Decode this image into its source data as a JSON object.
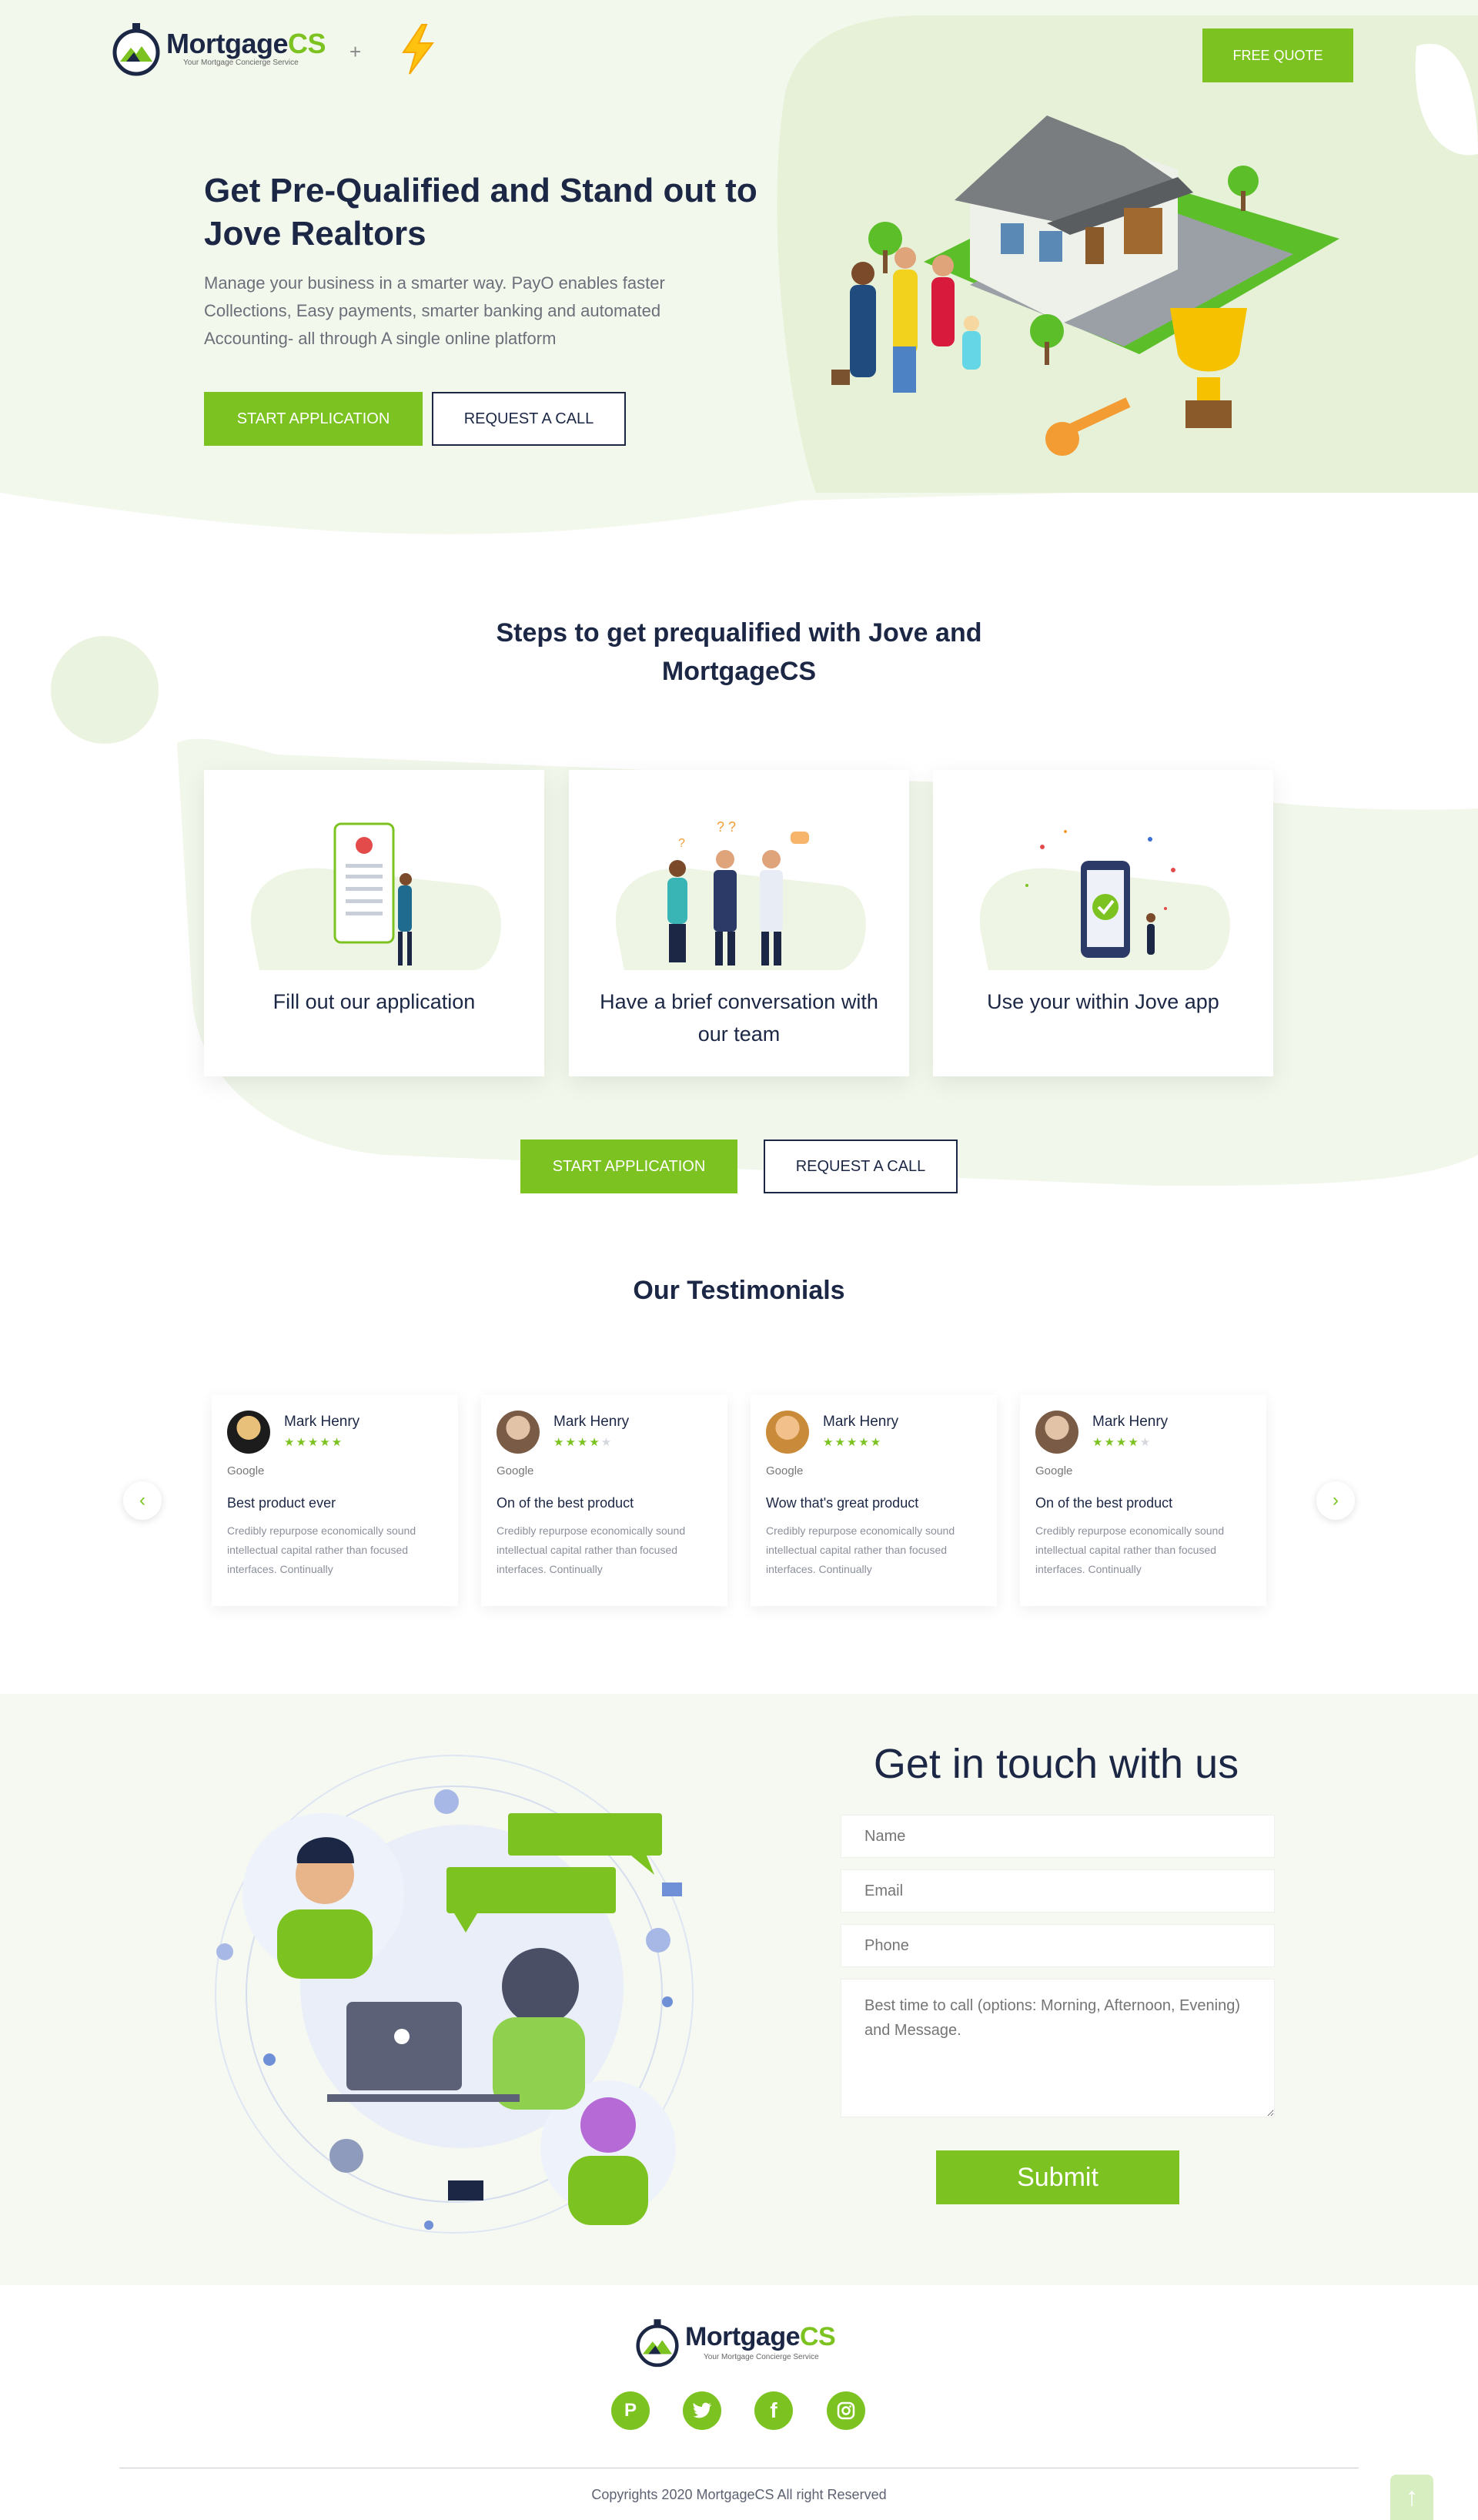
{
  "header": {
    "logo_main": "Mortgage",
    "logo_accent": "CS",
    "logo_tagline": "Your Mortgage Concierge Service",
    "plus": "+",
    "free_quote": "FREE QUOTE"
  },
  "hero": {
    "title": "Get Pre-Qualified and Stand out to Jove Realtors",
    "description": "Manage your business in a smarter way. PayO enables faster Collections, Easy payments, smarter banking and automated Accounting- all through A single online platform",
    "start_application": "START APPLICATION",
    "request_call": "REQUEST A CALL"
  },
  "steps": {
    "title": "Steps to get prequalified with Jove and MortgageCS",
    "items": [
      {
        "label": "Fill out our application",
        "icon": "phone-form-icon"
      },
      {
        "label": "Have a brief conversation with our team",
        "icon": "team-conversation-icon"
      },
      {
        "label": "Use your within Jove app",
        "icon": "phone-approved-icon"
      }
    ],
    "start_application": "START APPLICATION",
    "request_call": "REQUEST A CALL"
  },
  "testimonials": {
    "title": "Our Testimonials",
    "prev_icon": "chevron-left-icon",
    "next_icon": "chevron-right-icon",
    "items": [
      {
        "name": "Mark Henry",
        "stars": 5,
        "source": "Google",
        "title": "Best product ever",
        "body": "Credibly repurpose economically sound intellectual capital rather than focused interfaces. Continually"
      },
      {
        "name": "Mark Henry",
        "stars": 4,
        "source": "Google",
        "title": "On of the best product",
        "body": "Credibly repurpose economically sound intellectual capital rather than focused interfaces. Continually"
      },
      {
        "name": "Mark Henry",
        "stars": 5,
        "source": "Google",
        "title": "Wow that's great product",
        "body": "Credibly repurpose economically sound intellectual capital rather than focused interfaces. Continually"
      },
      {
        "name": "Mark Henry",
        "stars": 4,
        "source": "Google",
        "title": "On of the best product",
        "body": "Credibly repurpose economically sound intellectual capital rather than focused interfaces. Continually"
      }
    ]
  },
  "contact": {
    "title": "Get in touch with us",
    "name_placeholder": "Name",
    "email_placeholder": "Email",
    "phone_placeholder": "Phone",
    "message_placeholder": "Best time to call (options: Morning, Afternoon, Evening) and Message.",
    "submit": "Submit"
  },
  "footer": {
    "logo_main": "Mortgage",
    "logo_accent": "CS",
    "logo_tagline": "Your Mortgage Concierge Service",
    "social": [
      "pinterest-icon",
      "twitter-icon",
      "facebook-icon",
      "instagram-icon"
    ],
    "copyright": "Copyrights 2020 MortgageCS All right Reserved",
    "scroll_top_icon": "arrow-up-icon"
  },
  "colors": {
    "accent": "#7cc321",
    "navy": "#1c2745",
    "light_green_bg": "#eef5e4"
  }
}
